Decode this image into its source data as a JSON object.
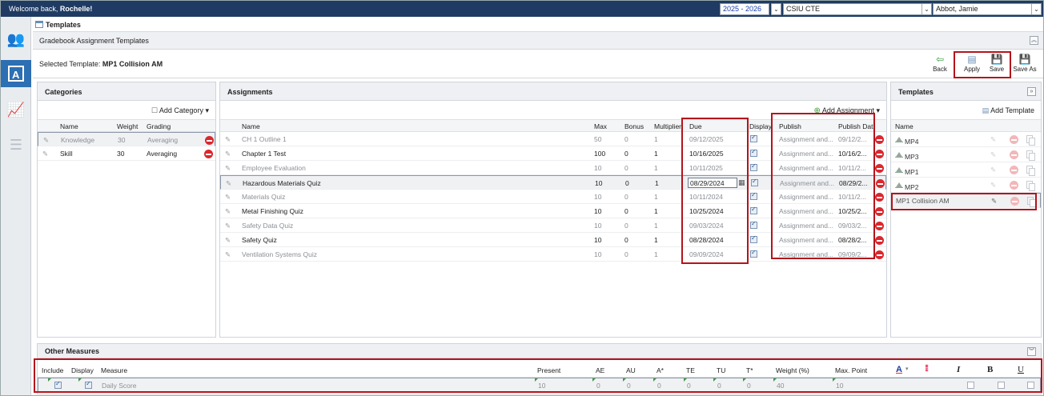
{
  "topbar": {
    "welcome_prefix": "Welcome back, ",
    "user": "Rochelle!",
    "year": "2025 - 2026",
    "building": "CSIU CTE",
    "teacher": "Abbot, Jamie"
  },
  "breadcrumb": {
    "title": "Templates"
  },
  "subheader": {
    "title": "Gradebook Assignment Templates"
  },
  "template_bar": {
    "selected_label": "Selected Template:",
    "selected_value": "MP1 Collision AM",
    "back": "Back",
    "apply": "Apply",
    "save": "Save",
    "save_as": "Save As"
  },
  "categories": {
    "title": "Categories",
    "add": "Add Category",
    "columns": [
      "Name",
      "Weight",
      "Grading"
    ],
    "rows": [
      {
        "name": "Knowledge",
        "weight": "30",
        "grading": "Averaging"
      },
      {
        "name": "Skill",
        "weight": "30",
        "grading": "Averaging"
      }
    ]
  },
  "assignments": {
    "title": "Assignments",
    "add": "Add Assignment",
    "columns": [
      "Name",
      "Max",
      "Bonus",
      "Multiplier",
      "Due",
      "Display",
      "Publish",
      "Publish Dat"
    ],
    "rows": [
      {
        "name": "CH 1 Outline 1",
        "max": "50",
        "bonus": "0",
        "mult": "1",
        "due": "09/12/2025",
        "publish": "Assignment and...",
        "pubdate": "09/12/2..."
      },
      {
        "name": "Chapter 1 Test",
        "max": "100",
        "bonus": "0",
        "mult": "1",
        "due": "10/16/2025",
        "publish": "Assignment and...",
        "pubdate": "10/16/2..."
      },
      {
        "name": "Employee Evaluation",
        "max": "10",
        "bonus": "0",
        "mult": "1",
        "due": "10/11/2025",
        "publish": "Assignment and...",
        "pubdate": "10/11/2..."
      },
      {
        "name": "Hazardous Materials Quiz",
        "max": "10",
        "bonus": "0",
        "mult": "1",
        "due": "08/29/2024",
        "publish": "Assignment and...",
        "pubdate": "08/29/2..."
      },
      {
        "name": "Materials Quiz",
        "max": "10",
        "bonus": "0",
        "mult": "1",
        "due": "10/11/2024",
        "publish": "Assignment and...",
        "pubdate": "10/11/2..."
      },
      {
        "name": "Metal Finishing Quiz",
        "max": "10",
        "bonus": "0",
        "mult": "1",
        "due": "10/25/2024",
        "publish": "Assignment and...",
        "pubdate": "10/25/2..."
      },
      {
        "name": "Safety Data Quiz",
        "max": "10",
        "bonus": "0",
        "mult": "1",
        "due": "09/03/2024",
        "publish": "Assignment and...",
        "pubdate": "09/03/2..."
      },
      {
        "name": "Safety Quiz",
        "max": "10",
        "bonus": "0",
        "mult": "1",
        "due": "08/28/2024",
        "publish": "Assignment and...",
        "pubdate": "08/28/2..."
      },
      {
        "name": "Ventilation Systems Quiz",
        "max": "10",
        "bonus": "0",
        "mult": "1",
        "due": "09/09/2024",
        "publish": "Assignment and...",
        "pubdate": "09/09/2..."
      }
    ]
  },
  "templates": {
    "title": "Templates",
    "add": "Add Template",
    "column": "Name",
    "rows": [
      "MP4",
      "MP3",
      "MP1",
      "MP2",
      "MP1 Collision AM"
    ]
  },
  "other_measures": {
    "title": "Other Measures",
    "columns": [
      "Include",
      "Display",
      "Measure",
      "Present",
      "AE",
      "AU",
      "A*",
      "TE",
      "TU",
      "T*",
      "Weight (%)",
      "Max. Point"
    ],
    "row": {
      "measure": "Daily Score",
      "present": "10",
      "ae": "0",
      "au": "0",
      "astar": "0",
      "te": "0",
      "tu": "0",
      "tstar": "0",
      "weight": "40",
      "maxpoint": "10"
    },
    "format": {
      "font_color": "A",
      "italic": "I",
      "bold": "B",
      "underline": "U"
    }
  },
  "colors": {
    "topbar": "#1f3b63",
    "active_rail": "#2c6fb3",
    "highlight": "#b3141c",
    "delete": "#d9282e"
  }
}
